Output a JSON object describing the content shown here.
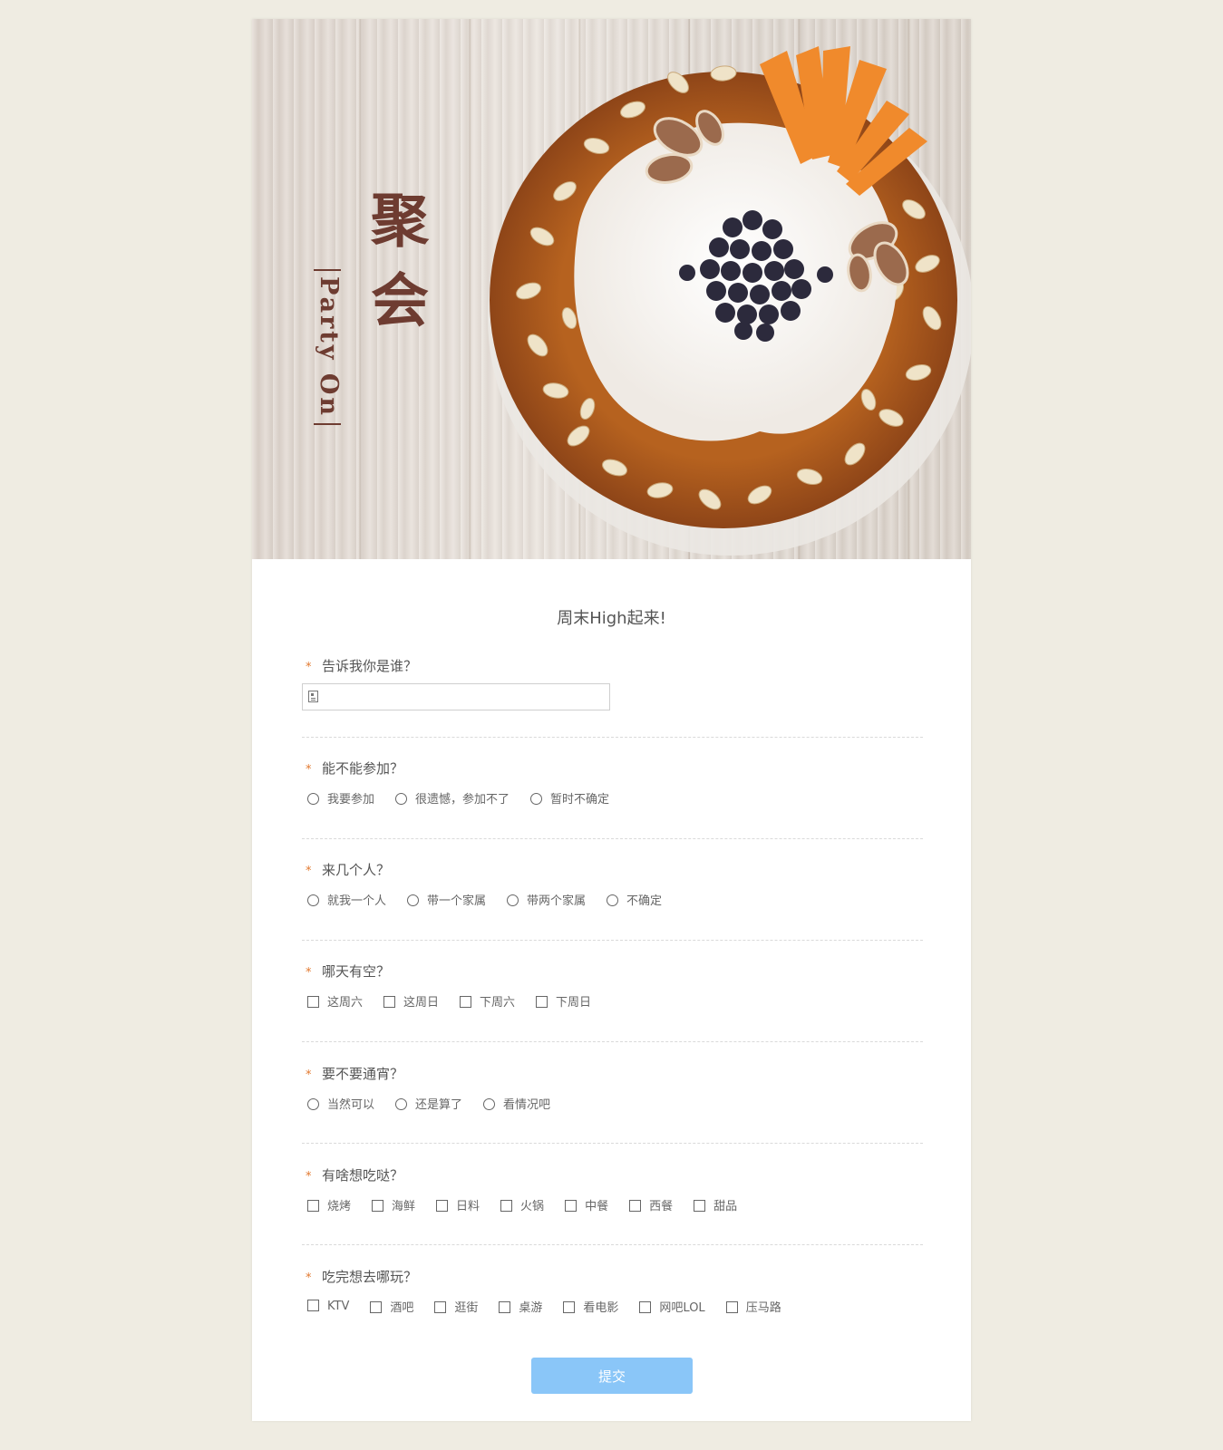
{
  "hero": {
    "title_line1": "聚",
    "title_line2": "会",
    "subtitle": "Party On"
  },
  "form": {
    "title": "周末High起来!",
    "required_mark": "*",
    "questions": [
      {
        "label": "告诉我你是谁？",
        "type": "text",
        "value": "",
        "placeholder": ""
      },
      {
        "label": "能不能参加？",
        "type": "radio",
        "options": [
          "我要参加",
          "很遗憾，参加不了",
          "暂时不确定"
        ]
      },
      {
        "label": "来几个人？",
        "type": "radio",
        "options": [
          "就我一个人",
          "带一个家属",
          "带两个家属",
          "不确定"
        ]
      },
      {
        "label": "哪天有空？",
        "type": "checkbox",
        "options": [
          "这周六",
          "这周日",
          "下周六",
          "下周日"
        ]
      },
      {
        "label": "要不要通宵？",
        "type": "radio",
        "options": [
          "当然可以",
          "还是算了",
          "看情况吧"
        ]
      },
      {
        "label": "有啥想吃哒？",
        "type": "checkbox",
        "options": [
          "烧烤",
          "海鲜",
          "日料",
          "火锅",
          "中餐",
          "西餐",
          "甜品"
        ]
      },
      {
        "label": "吃完想去哪玩？",
        "type": "checkbox",
        "options": [
          "KTV",
          "酒吧",
          "逛街",
          "桌游",
          "看电影",
          "网吧LOL",
          "压马路"
        ]
      }
    ],
    "submit_label": "提交"
  },
  "colors": {
    "background": "#efece2",
    "accent_required": "#e2792f",
    "submit_button": "#8ac6f8",
    "hero_text": "#6e3c31"
  }
}
